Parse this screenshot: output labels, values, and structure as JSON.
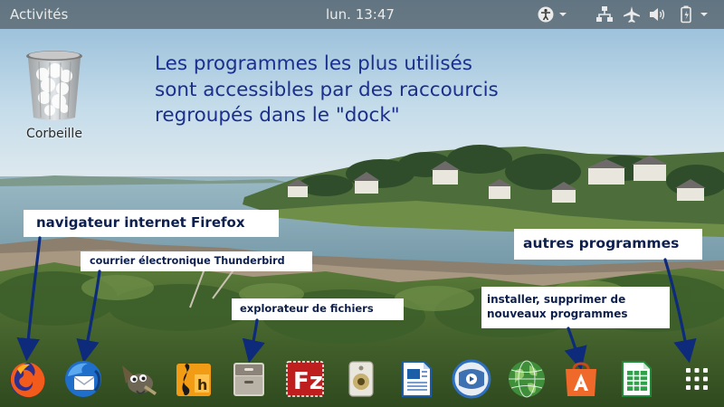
{
  "topbar": {
    "activities_label": "Activités",
    "clock": "lun. 13:47",
    "tray_icons": [
      "accessibility-icon",
      "network-icon",
      "airplane-mode-icon",
      "volume-icon",
      "battery-icon"
    ]
  },
  "desktop": {
    "trash_label": "Corbeille",
    "headline_lines": [
      "Les programmes les plus utilisés",
      "sont accessibles par des raccourcis",
      "regroupés dans le \"dock\""
    ]
  },
  "callouts": {
    "firefox": "navigateur internet Firefox",
    "thunderbird": "courrier électronique Thunderbird",
    "files": "explorateur de fichiers",
    "install_lines": [
      "installer, supprimer de",
      "nouveaux programmes"
    ],
    "others": "autres programmes"
  },
  "dock": {
    "items": [
      "firefox-icon",
      "thunderbird-icon",
      "gimp-icon",
      "music-editor-icon",
      "files-icon",
      "filezilla-icon",
      "audio-player-icon",
      "writer-icon",
      "media-player-icon",
      "globe-browser-icon",
      "software-center-icon",
      "calc-icon",
      "show-applications-icon"
    ]
  },
  "colors": {
    "headline": "#1b2f8c",
    "callout_text": "#0d1f4d",
    "arrow": "#0d2b7a",
    "topbar": "#3c3c3c"
  }
}
